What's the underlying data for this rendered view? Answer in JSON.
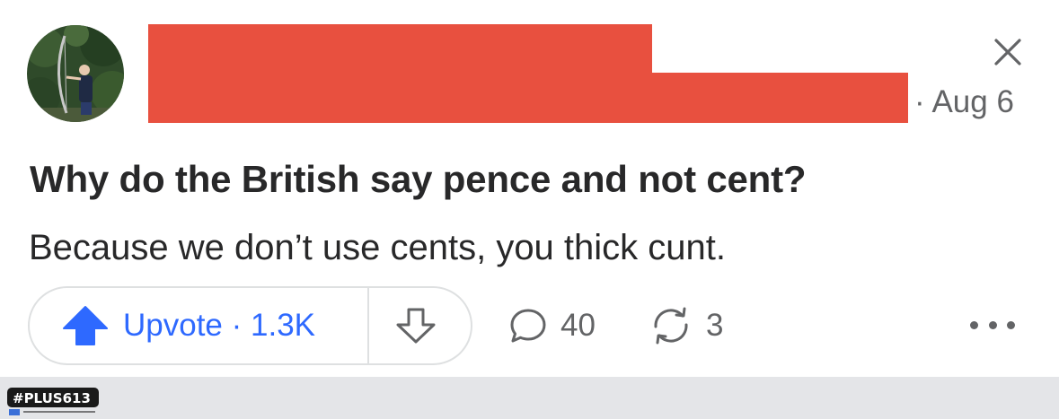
{
  "post": {
    "date": "· Aug 6",
    "question": "Why do the British say pence and not cent?",
    "answer": "Because we don’t use cents, you thick cunt."
  },
  "actions": {
    "upvote_label": "Upvote · 1.3K",
    "comments_count": "40",
    "shares_count": "3"
  },
  "icons": {
    "close": "close-icon",
    "upvote": "arrow-up-icon",
    "downvote": "arrow-down-icon",
    "comment": "comment-icon",
    "share": "reshare-icon",
    "more": "more-icon"
  },
  "watermark": {
    "text": "#PLUS613"
  },
  "colors": {
    "redaction": "#e8503f",
    "upvote_blue": "#2e69ff",
    "muted_text": "#636466",
    "footer_bg": "#e4e5e8"
  }
}
